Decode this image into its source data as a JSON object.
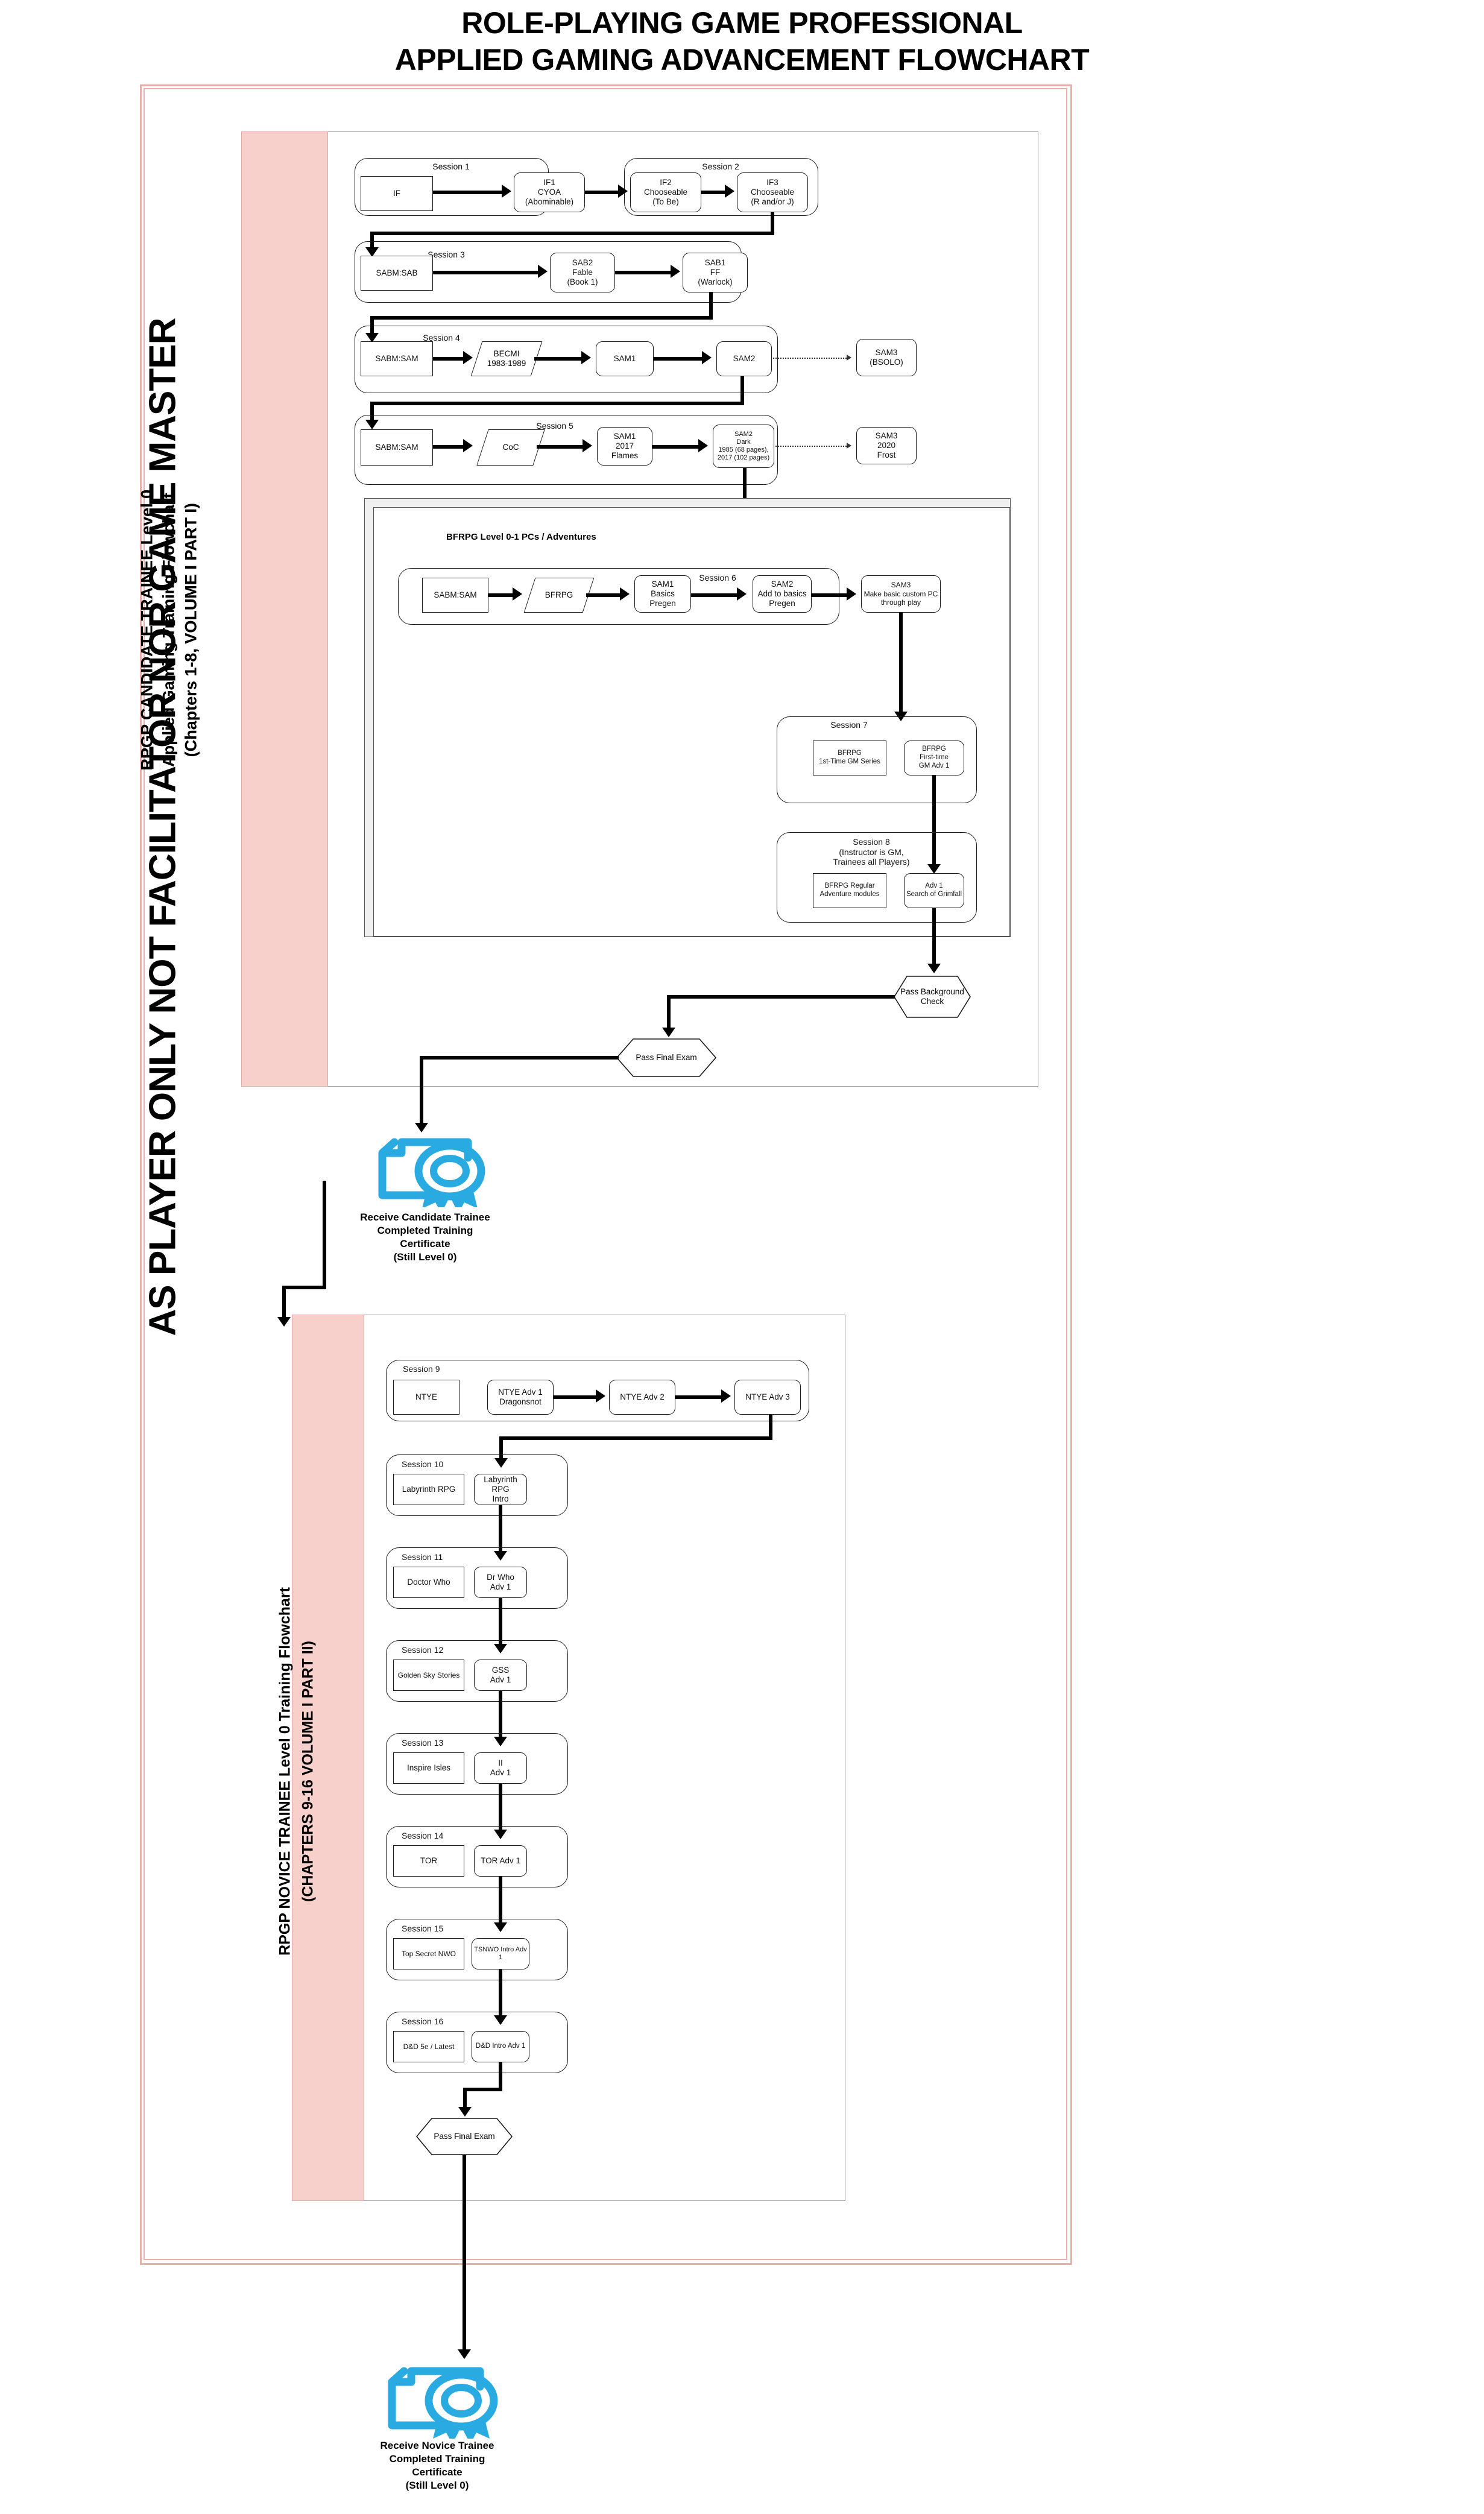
{
  "title": {
    "line1": "ROLE-PLAYING GAME PROFESSIONAL",
    "line2": "APPLIED GAMING ADVANCEMENT FLOWCHART"
  },
  "slogan": "AS PLAYER ONLY NOT FACILITATOR NOR GAME MASTER",
  "part1": {
    "band_label": "RPGP CANDIDATE TRAINEE Level 0\nApplied Gaming Training Flowchart\n(Chapters 1-8, VOLUME I PART I)",
    "sessions": [
      {
        "label": "Session 1",
        "nodes": [
          {
            "text": "IF",
            "shape": "square"
          },
          {
            "text": "IF1\nCYOA\n(Abominable)",
            "shape": "round"
          }
        ]
      },
      {
        "label": "Session 2",
        "nodes": [
          {
            "text": "IF2\nChooseable\n(To Be)",
            "shape": "round"
          },
          {
            "text": "IF3\nChooseable\n(R and/or J)",
            "shape": "round"
          }
        ]
      },
      {
        "label": "Session 3",
        "nodes": [
          {
            "text": "SABM:SAB",
            "shape": "square"
          },
          {
            "text": "SAB2\nFable\n(Book 1)",
            "shape": "round"
          },
          {
            "text": "SAB1\nFF\n(Warlock)",
            "shape": "round"
          }
        ]
      },
      {
        "label": "Session 4",
        "nodes": [
          {
            "text": "SABM:SAM",
            "shape": "square"
          },
          {
            "text": "BECMI\n1983-1989",
            "shape": "parallelogram"
          },
          {
            "text": "SAM1",
            "shape": "round"
          },
          {
            "text": "SAM2",
            "shape": "round"
          },
          {
            "text": "SAM3\n(BSOLO)",
            "shape": "round"
          }
        ]
      },
      {
        "label": "Session 5",
        "nodes": [
          {
            "text": "SABM:SAM",
            "shape": "square"
          },
          {
            "text": "CoC",
            "shape": "parallelogram"
          },
          {
            "text": "SAM1\n2017\nFlames",
            "shape": "round"
          },
          {
            "text": "SAM2\nDark\n1985 (68 pages),\n2017 (102 pages)",
            "shape": "round"
          },
          {
            "text": "SAM3\n2020\nFrost",
            "shape": "round"
          }
        ]
      },
      {
        "label": "Session 6",
        "nodes": [
          {
            "text": "SABM:SAM",
            "shape": "square"
          },
          {
            "text": "BFRPG",
            "shape": "parallelogram"
          },
          {
            "text": "SAM1\nBasics\nPregen",
            "shape": "round"
          },
          {
            "text": "SAM2\nAdd to basics\nPregen",
            "shape": "round"
          },
          {
            "text": "SAM3\nMake basic custom PC\nthrough play",
            "shape": "round"
          }
        ]
      },
      {
        "label": "Session 7",
        "nodes": [
          {
            "text": "BFRPG\n1st-Time GM Series",
            "shape": "square"
          },
          {
            "text": "BFRPG\nFirst-time\nGM Adv 1",
            "shape": "round"
          }
        ]
      },
      {
        "label": "Session 8\n(Instructor is GM,\nTrainees all Players)",
        "nodes": [
          {
            "text": "BFRPG Regular\nAdventure modules",
            "shape": "square"
          },
          {
            "text": "Adv 1\nSearch of Grimfall",
            "shape": "round"
          }
        ]
      }
    ],
    "container_label": "BFRPG Level 0-1 PCs / Adventures",
    "gates": [
      {
        "text": "Pass Background\nCheck"
      },
      {
        "text": "Pass Final Exam"
      }
    ],
    "certificate": {
      "icon": "certificate-ribbon-icon",
      "caption": "Receive Candidate Trainee\nCompleted Training\nCertificate\n(Still Level 0)",
      "color": "#29abe2"
    }
  },
  "part2": {
    "band_label": "RPGP NOVICE TRAINEE Level 0 Training Flowchart\n(CHAPTERS 9-16 VOLUME I PART II)",
    "sessions": [
      {
        "label": "Session 9",
        "nodes": [
          {
            "text": "NTYE",
            "shape": "square"
          },
          {
            "text": "NTYE Adv 1\nDragonsnot",
            "shape": "round"
          },
          {
            "text": "NTYE Adv 2",
            "shape": "round"
          },
          {
            "text": "NTYE Adv 3",
            "shape": "round"
          }
        ]
      },
      {
        "label": "Session 10",
        "nodes": [
          {
            "text": "Labyrinth RPG",
            "shape": "square"
          },
          {
            "text": "Labyrinth RPG\nIntro",
            "shape": "round"
          }
        ]
      },
      {
        "label": "Session 11",
        "nodes": [
          {
            "text": "Doctor Who",
            "shape": "square"
          },
          {
            "text": "Dr Who\nAdv 1",
            "shape": "round"
          }
        ]
      },
      {
        "label": "Session 12",
        "nodes": [
          {
            "text": "Golden Sky Stories",
            "shape": "square"
          },
          {
            "text": "GSS\nAdv 1",
            "shape": "round"
          }
        ]
      },
      {
        "label": "Session 13",
        "nodes": [
          {
            "text": "Inspire Isles",
            "shape": "square"
          },
          {
            "text": "II\nAdv 1",
            "shape": "round"
          }
        ]
      },
      {
        "label": "Session 14",
        "nodes": [
          {
            "text": "TOR",
            "shape": "square"
          },
          {
            "text": "TOR Adv 1",
            "shape": "round"
          }
        ]
      },
      {
        "label": "Session 15",
        "nodes": [
          {
            "text": "Top Secret NWO",
            "shape": "square"
          },
          {
            "text": "TSNWO Intro Adv 1",
            "shape": "round"
          }
        ]
      },
      {
        "label": "Session 16",
        "nodes": [
          {
            "text": "D&D 5e / Latest",
            "shape": "square"
          },
          {
            "text": "D&D Intro Adv 1",
            "shape": "round"
          }
        ]
      }
    ],
    "gates": [
      {
        "text": "Pass Final Exam"
      }
    ],
    "certificate": {
      "icon": "certificate-ribbon-icon",
      "caption": "Receive Novice Trainee\nCompleted Training\nCertificate\n(Still Level 0)",
      "color": "#29abe2"
    }
  },
  "colors": {
    "frame": "#e8b0aa",
    "band": "#f7cfcb",
    "accent": "#29abe2",
    "line": "#000000"
  }
}
